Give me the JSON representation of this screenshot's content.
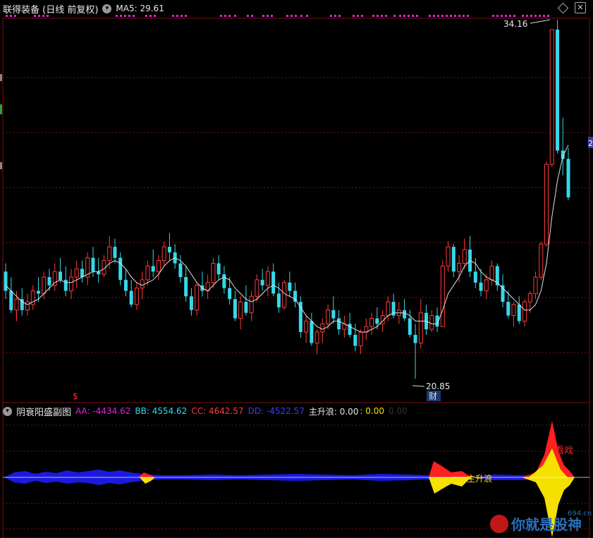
{
  "header": {
    "title": "联得装备 (日线 前复权)",
    "ma_label": "MA5: 29.61"
  },
  "main_chart": {
    "high_label": "34.16",
    "low_label": "20.85",
    "fin_tag": "财",
    "signal_tag": "$",
    "right_tag": "2"
  },
  "sub_chart": {
    "title": "阴衰阳盛副图",
    "aa": "AA: -4434.62",
    "bb": "BB: 4554.62",
    "cc": "CC: 4642.57",
    "dd": "DD: -4522.57",
    "zsl_a": "主升浪: 0.00",
    "zsl_b": ": 0.00",
    "zsl_c": "0.00",
    "label_zsl": "主升浪",
    "label_zx": "看戏"
  },
  "watermark": {
    "site": "694.cn",
    "slogan": "你就是股神"
  },
  "colors": {
    "up": "#ff3b3b",
    "down": "#36d8e8",
    "ma": "#e0e0e0",
    "magenta": "#e020e0",
    "blue": "#1a1adf",
    "yellow": "#f5e000",
    "grid": "#7a1010"
  },
  "chart_data": {
    "type": "candlestick",
    "ylim": [
      20.85,
      34.16
    ],
    "candles": [
      [
        25.0,
        25.3,
        24.0,
        24.3
      ],
      [
        24.3,
        24.8,
        23.5,
        23.6
      ],
      [
        23.6,
        24.3,
        23.2,
        24.0
      ],
      [
        24.0,
        24.4,
        23.4,
        23.6
      ],
      [
        23.6,
        24.2,
        23.4,
        23.9
      ],
      [
        23.8,
        24.5,
        23.6,
        24.3
      ],
      [
        24.3,
        24.8,
        23.9,
        24.2
      ],
      [
        24.2,
        25.0,
        24.0,
        24.8
      ],
      [
        24.8,
        25.1,
        24.3,
        24.5
      ],
      [
        24.5,
        25.3,
        24.3,
        25.0
      ],
      [
        25.0,
        25.5,
        24.6,
        24.7
      ],
      [
        24.7,
        25.2,
        24.1,
        24.3
      ],
      [
        24.3,
        25.1,
        24.0,
        24.8
      ],
      [
        24.8,
        25.4,
        24.4,
        25.1
      ],
      [
        25.1,
        25.4,
        24.6,
        24.8
      ],
      [
        24.8,
        25.7,
        24.5,
        25.5
      ],
      [
        25.5,
        25.9,
        24.8,
        25.0
      ],
      [
        25.0,
        25.5,
        24.6,
        24.9
      ],
      [
        24.9,
        25.6,
        24.8,
        25.4
      ],
      [
        25.4,
        26.3,
        25.1,
        25.9
      ],
      [
        25.9,
        26.2,
        25.3,
        25.5
      ],
      [
        25.5,
        25.7,
        24.5,
        24.7
      ],
      [
        24.7,
        25.1,
        24.1,
        24.3
      ],
      [
        24.3,
        24.7,
        23.7,
        23.8
      ],
      [
        23.8,
        24.6,
        23.6,
        24.4
      ],
      [
        24.4,
        25.0,
        24.0,
        24.7
      ],
      [
        24.7,
        25.4,
        24.5,
        25.2
      ],
      [
        25.2,
        25.8,
        24.8,
        25.0
      ],
      [
        25.0,
        25.6,
        24.7,
        25.4
      ],
      [
        25.4,
        26.1,
        25.2,
        25.9
      ],
      [
        25.9,
        26.4,
        25.4,
        25.7
      ],
      [
        25.7,
        26.0,
        25.1,
        25.3
      ],
      [
        25.3,
        25.6,
        24.6,
        24.8
      ],
      [
        24.8,
        25.2,
        23.9,
        24.1
      ],
      [
        24.1,
        24.4,
        23.4,
        23.6
      ],
      [
        23.6,
        24.6,
        23.4,
        24.5
      ],
      [
        24.5,
        25.0,
        24.1,
        24.3
      ],
      [
        24.3,
        24.9,
        24.0,
        24.6
      ],
      [
        24.6,
        25.5,
        24.4,
        25.3
      ],
      [
        25.3,
        25.6,
        24.7,
        24.9
      ],
      [
        24.9,
        25.2,
        24.2,
        24.4
      ],
      [
        24.4,
        24.8,
        23.8,
        24.0
      ],
      [
        24.0,
        24.3,
        23.2,
        23.3
      ],
      [
        23.3,
        24.1,
        22.9,
        23.9
      ],
      [
        23.9,
        24.5,
        23.4,
        23.5
      ],
      [
        23.5,
        24.3,
        23.2,
        24.1
      ],
      [
        24.1,
        24.9,
        23.9,
        24.7
      ],
      [
        24.7,
        25.1,
        24.3,
        24.5
      ],
      [
        24.5,
        25.2,
        24.1,
        25.0
      ],
      [
        25.0,
        25.3,
        24.1,
        24.2
      ],
      [
        24.2,
        24.6,
        23.5,
        23.7
      ],
      [
        23.7,
        24.7,
        23.6,
        24.6
      ],
      [
        24.6,
        25.0,
        24.1,
        24.3
      ],
      [
        24.3,
        24.6,
        23.7,
        23.9
      ],
      [
        23.9,
        24.1,
        22.6,
        22.8
      ],
      [
        22.8,
        23.4,
        22.4,
        23.2
      ],
      [
        23.2,
        23.5,
        22.3,
        22.4
      ],
      [
        22.4,
        22.9,
        22.0,
        22.8
      ],
      [
        22.8,
        23.3,
        22.4,
        23.1
      ],
      [
        23.1,
        23.8,
        22.9,
        23.6
      ],
      [
        23.6,
        24.1,
        23.1,
        23.3
      ],
      [
        23.3,
        23.6,
        22.7,
        22.9
      ],
      [
        22.9,
        23.4,
        22.6,
        23.1
      ],
      [
        23.1,
        23.5,
        22.6,
        22.7
      ],
      [
        22.7,
        23.1,
        22.1,
        22.3
      ],
      [
        22.3,
        22.9,
        22.0,
        22.8
      ],
      [
        22.8,
        23.3,
        22.5,
        23.0
      ],
      [
        23.0,
        23.5,
        22.7,
        23.3
      ],
      [
        23.3,
        23.7,
        22.9,
        23.1
      ],
      [
        23.1,
        23.6,
        22.8,
        23.4
      ],
      [
        23.4,
        24.1,
        23.2,
        23.9
      ],
      [
        23.9,
        24.2,
        23.3,
        23.4
      ],
      [
        23.4,
        23.9,
        23.1,
        23.6
      ],
      [
        23.6,
        24.0,
        23.2,
        23.3
      ],
      [
        23.3,
        23.6,
        22.6,
        22.7
      ],
      [
        22.7,
        23.1,
        21.1,
        22.4
      ],
      [
        22.4,
        24.0,
        22.2,
        23.5
      ],
      [
        23.5,
        23.8,
        22.7,
        22.9
      ],
      [
        22.9,
        23.6,
        22.8,
        23.4
      ],
      [
        23.4,
        23.7,
        22.8,
        23.0
      ],
      [
        23.0,
        25.4,
        23.0,
        25.2
      ],
      [
        25.2,
        26.1,
        25.0,
        25.9
      ],
      [
        25.9,
        26.0,
        24.8,
        25.0
      ],
      [
        25.0,
        25.6,
        24.6,
        25.3
      ],
      [
        25.3,
        26.2,
        25.1,
        25.8
      ],
      [
        25.8,
        26.3,
        24.8,
        25.0
      ],
      [
        25.0,
        25.5,
        24.4,
        24.6
      ],
      [
        24.6,
        25.1,
        24.1,
        24.3
      ],
      [
        24.3,
        24.9,
        24.0,
        24.7
      ],
      [
        24.7,
        25.4,
        24.5,
        25.2
      ],
      [
        25.2,
        25.3,
        24.3,
        24.5
      ],
      [
        24.5,
        24.9,
        23.7,
        23.9
      ],
      [
        23.9,
        24.3,
        23.3,
        23.4
      ],
      [
        23.4,
        23.9,
        23.0,
        23.8
      ],
      [
        23.8,
        24.1,
        23.1,
        23.2
      ],
      [
        23.2,
        24.0,
        23.0,
        23.9
      ],
      [
        23.9,
        24.3,
        23.5,
        24.2
      ],
      [
        24.2,
        25.0,
        24.0,
        24.8
      ],
      [
        24.8,
        26.1,
        24.7,
        26.0
      ],
      [
        26.0,
        29.0,
        25.9,
        28.9
      ],
      [
        28.9,
        33.8,
        28.8,
        33.8
      ],
      [
        33.8,
        34.16,
        29.3,
        29.4
      ],
      [
        29.4,
        30.6,
        28.5,
        29.1
      ],
      [
        29.1,
        29.5,
        27.6,
        27.7
      ]
    ],
    "ma5": [
      24.5,
      24.3,
      24.1,
      23.9,
      23.8,
      23.9,
      24.0,
      24.2,
      24.4,
      24.6,
      24.7,
      24.6,
      24.6,
      24.7,
      24.8,
      24.9,
      25.0,
      25.0,
      25.1,
      25.3,
      25.4,
      25.3,
      25.1,
      24.8,
      24.6,
      24.5,
      24.6,
      24.7,
      24.9,
      25.2,
      25.4,
      25.5,
      25.4,
      25.2,
      24.9,
      24.6,
      24.4,
      24.3,
      24.5,
      24.7,
      24.8,
      24.7,
      24.4,
      24.2,
      24.0,
      23.9,
      24.0,
      24.2,
      24.4,
      24.5,
      24.4,
      24.2,
      24.1,
      24.0,
      23.7,
      23.4,
      23.2,
      23.0,
      22.9,
      23.0,
      23.2,
      23.2,
      23.1,
      23.0,
      22.9,
      22.8,
      22.8,
      22.9,
      23.0,
      23.2,
      23.4,
      23.5,
      23.5,
      23.5,
      23.4,
      23.2,
      23.2,
      23.2,
      23.1,
      23.1,
      23.6,
      24.2,
      24.5,
      24.8,
      25.2,
      25.4,
      25.3,
      25.0,
      24.8,
      24.7,
      24.6,
      24.4,
      24.2,
      24.0,
      23.8,
      23.6,
      23.6,
      23.8,
      24.3,
      25.3,
      27.0,
      28.3,
      29.2,
      29.6
    ]
  }
}
